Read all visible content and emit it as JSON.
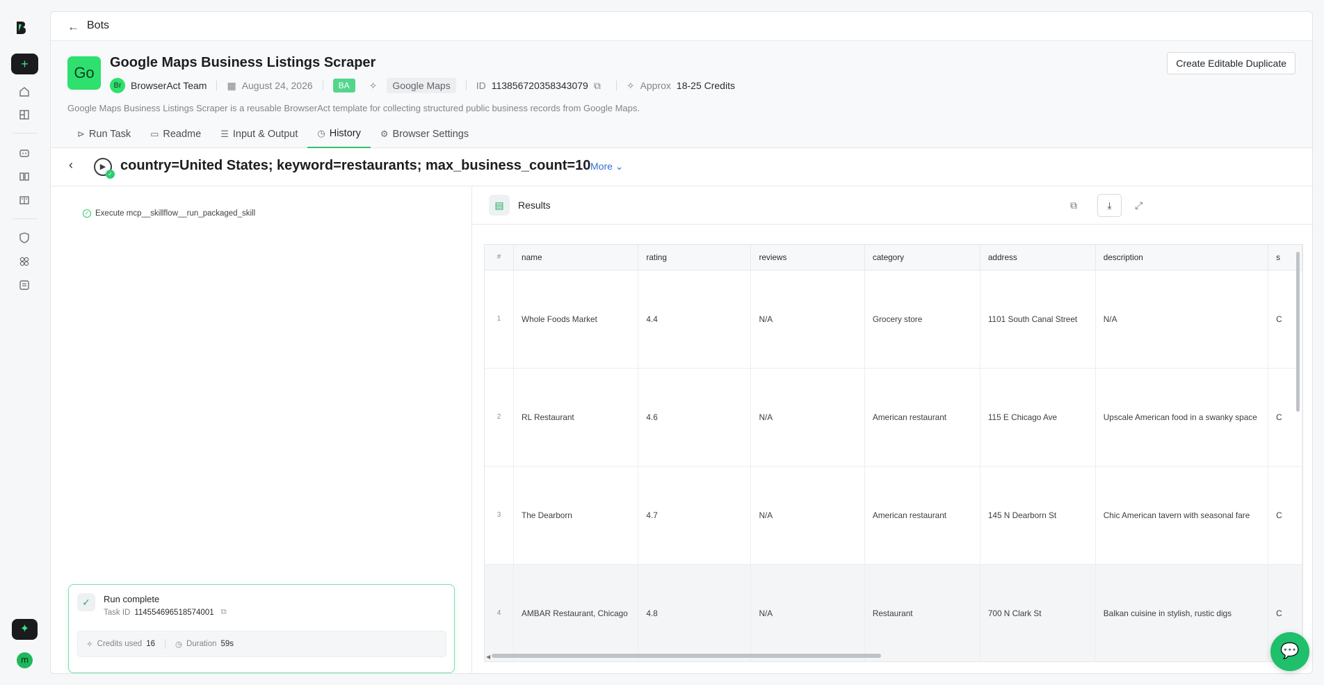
{
  "nav": {
    "back_label": "Bots"
  },
  "bot": {
    "badge": "Go",
    "title": "Google Maps Business Listings Scraper",
    "author_avatar": "Br",
    "author": "BrowserAct Team",
    "date": "August 24, 2026",
    "tag": "BA",
    "category": "Google Maps",
    "id_label": "ID",
    "id_value": "1138567203583430‌79",
    "approx_label": "Approx",
    "credits": "18-25 Credits",
    "description": "Google Maps Business Listings Scraper is a reusable BrowserAct template for collecting structured public business records from Google Maps.",
    "duplicate_button": "Create Editable Duplicate"
  },
  "tabs": [
    {
      "label": "Run Task",
      "icon": "play-icon"
    },
    {
      "label": "Readme",
      "icon": "book-icon"
    },
    {
      "label": "Input & Output",
      "icon": "list-icon"
    },
    {
      "label": "History",
      "icon": "clock-icon"
    },
    {
      "label": "Browser Settings",
      "icon": "gear-icon"
    }
  ],
  "run": {
    "title": "country=United States; keyword=restaurants; max_business_count=10",
    "more_label": "More"
  },
  "steps": [
    {
      "label": "Execute mcp__skillflow__run_packaged_skill"
    }
  ],
  "status_card": {
    "title": "Run complete",
    "task_id_label": "Task ID",
    "task_id": "114554696518574001",
    "credits_label": "Credits used",
    "credits_value": "16",
    "duration_label": "Duration",
    "duration_value": "59s"
  },
  "results": {
    "title": "Results",
    "columns": [
      "#",
      "name",
      "rating",
      "reviews",
      "category",
      "address",
      "description",
      "s"
    ],
    "rows": [
      {
        "n": "1",
        "name": "Whole Foods Market",
        "rating": "4.4",
        "reviews": "N/A",
        "category": "Grocery store",
        "address": "1101 South Canal Street",
        "description": "N/A",
        "s": "C"
      },
      {
        "n": "2",
        "name": "RL Restaurant",
        "rating": "4.6",
        "reviews": "N/A",
        "category": "American restaurant",
        "address": "115 E Chicago Ave",
        "description": "Upscale American food in a swanky space",
        "s": "C"
      },
      {
        "n": "3",
        "name": "The Dearborn",
        "rating": "4.7",
        "reviews": "N/A",
        "category": "American restaurant",
        "address": "145 N Dearborn St",
        "description": "Chic American tavern with seasonal fare",
        "s": "C"
      },
      {
        "n": "4",
        "name": "AMBAR Restaurant, Chicago",
        "rating": "4.8",
        "reviews": "N/A",
        "category": "Restaurant",
        "address": "700 N Clark St",
        "description": "Balkan cuisine in stylish, rustic digs",
        "s": "C"
      }
    ]
  },
  "user": {
    "avatar": "m"
  },
  "colors": {
    "accent": "#2ee06e",
    "link": "#2f6fd6"
  }
}
